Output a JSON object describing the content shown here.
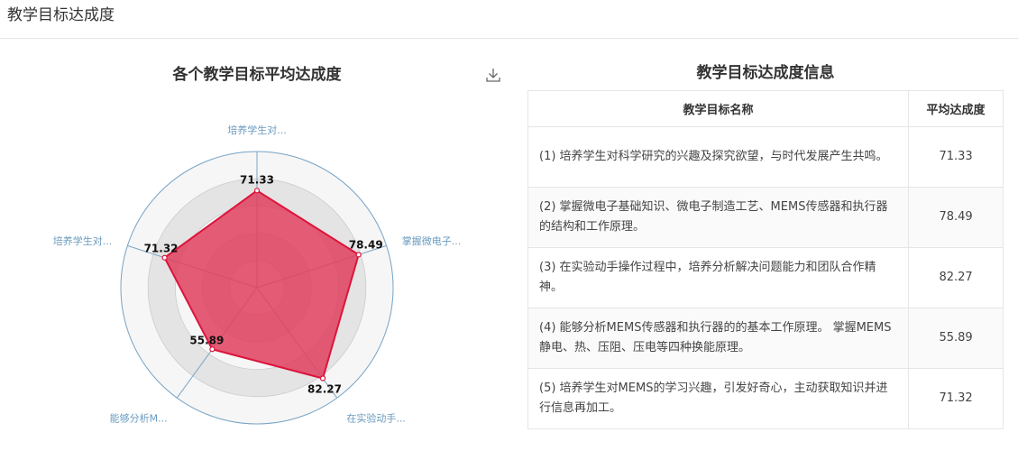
{
  "page": {
    "title": "教学目标达成度"
  },
  "chart": {
    "title": "各个教学目标平均达成度"
  },
  "table": {
    "title": "教学目标达成度信息",
    "headers": [
      "教学目标名称",
      "平均达成度"
    ],
    "rows": [
      {
        "name": "(1) 培养学生对科学研究的兴趣及探究欲望，与时代发展产生共鸣。",
        "value": "71.33"
      },
      {
        "name": "(2) 掌握微电子基础知识、微电子制造工艺、MEMS传感器和执行器的结构和工作原理。",
        "value": "78.49"
      },
      {
        "name": "(3) 在实验动手操作过程中，培养分析解决问题能力和团队合作精神。",
        "value": "82.27"
      },
      {
        "name": "(4) 能够分析MEMS传感器和执行器的的基本工作原理。 掌握MEMS静电、热、压阻、压电等四种换能原理。",
        "value": "55.89"
      },
      {
        "name": "(5) 培养学生对MEMS的学习兴趣，引发好奇心，主动获取知识并进行信息再加工。",
        "value": "71.32"
      }
    ]
  },
  "chart_data": {
    "type": "radar",
    "title": "各个教学目标平均达成度",
    "indicators": [
      "培养学生对...",
      "掌握微电子...",
      "在实验动手...",
      "能够分析M...",
      "培养学生对..."
    ],
    "max": 100,
    "values": [
      71.33,
      78.49,
      82.27,
      55.89,
      71.32
    ],
    "value_labels": [
      "71.33",
      "78.49",
      "82.27",
      "55.89",
      "71.32"
    ],
    "colors": {
      "area": "#e0405e",
      "line": "#dc143c",
      "axis": "#7aa6c8",
      "label": "#6a9bbf"
    }
  }
}
